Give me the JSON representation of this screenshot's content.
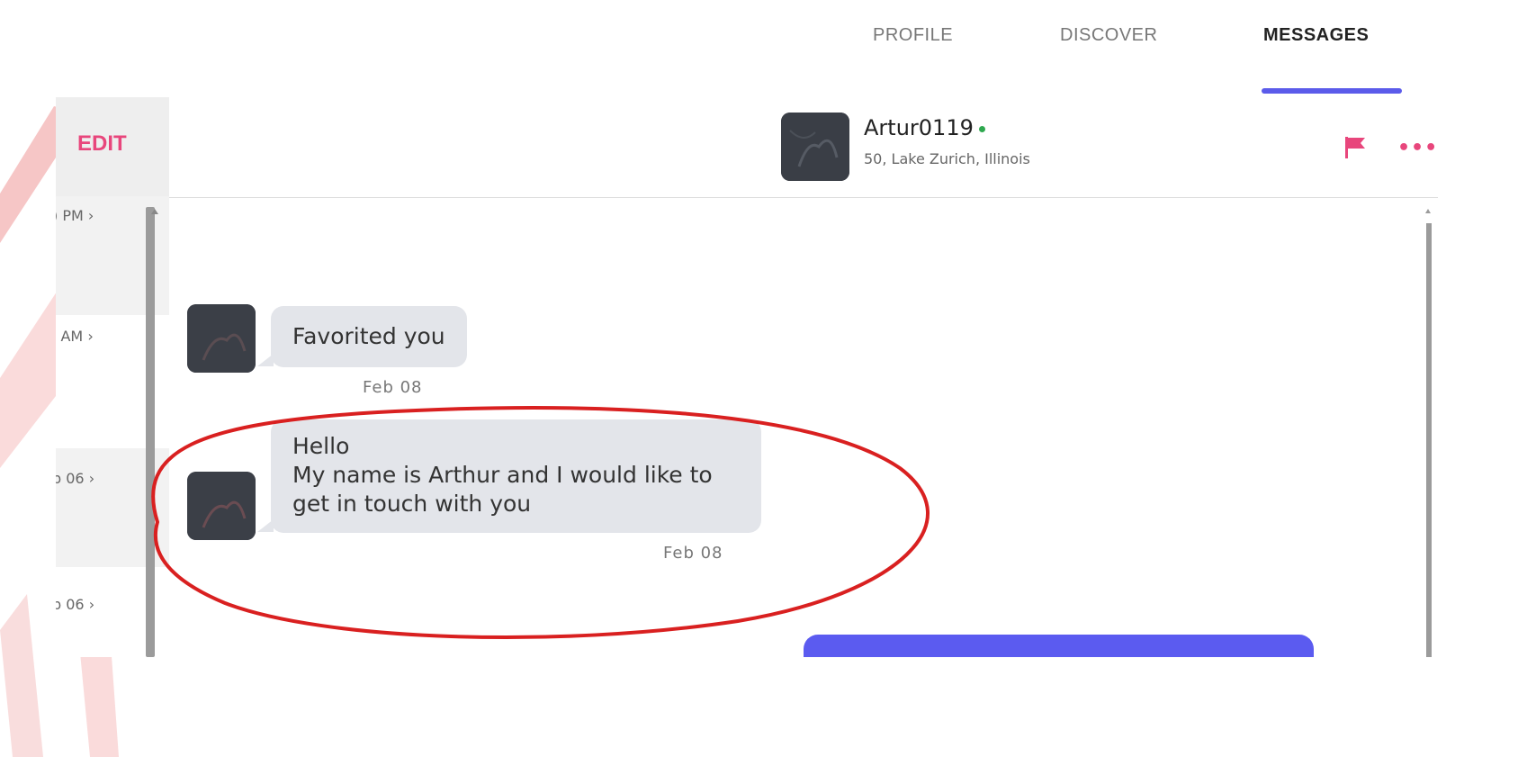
{
  "nav": {
    "profile": "PROFILE",
    "discover": "DISCOVER",
    "messages": "MESSAGES",
    "active": "MESSAGES"
  },
  "left_panel": {
    "edit_label": "EDIT",
    "conversations": [
      {
        "time": ") PM ›"
      },
      {
        "time": "' AM ›"
      },
      {
        "time": "b 06 ›"
      },
      {
        "time": "b 06 ›"
      }
    ]
  },
  "chat_header": {
    "username": "Artur0119",
    "online": true,
    "subtitle": "50, Lake Zurich, Illinois"
  },
  "messages": [
    {
      "direction": "in",
      "lines": [
        "Favorited you"
      ],
      "date": "Feb 08"
    },
    {
      "direction": "in",
      "lines": [
        "Hello",
        "My name is Arthur and I would like to",
        "get in touch with you"
      ],
      "date": "Feb 08"
    },
    {
      "direction": "out",
      "lines": []
    }
  ],
  "colors": {
    "accent_pink": "#e8467c",
    "accent_purple": "#5b5bea",
    "incoming_bubble": "#e3e5ea",
    "outgoing_bubble": "#5b5bf0",
    "online_green": "#2fa84f",
    "annotation_red": "#d92020"
  },
  "icons": {
    "flag": "flag-icon",
    "more": "more-options-icon"
  }
}
